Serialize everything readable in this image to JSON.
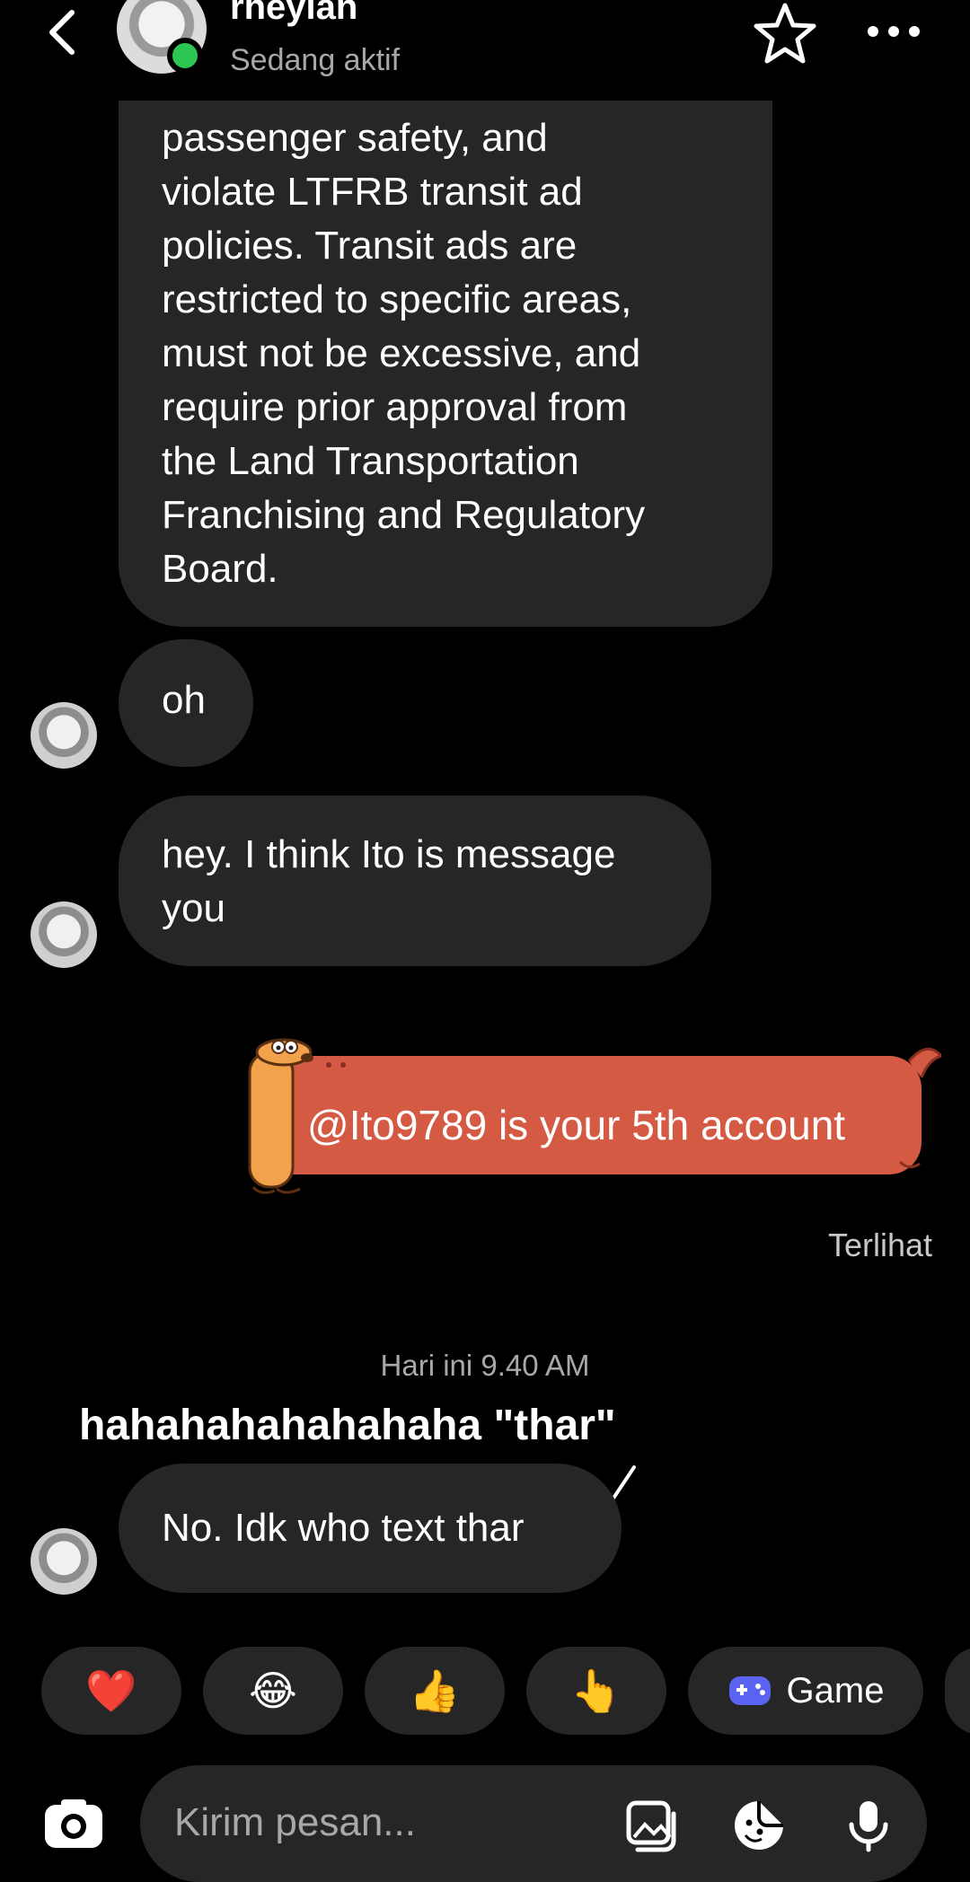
{
  "header": {
    "name": "rheylan",
    "status": "Sedang aktif"
  },
  "messages": {
    "received_long": "passenger safety, and\nviolate LTFRB transit ad\npolicies. Transit ads are\nrestricted to specific areas,\nmust not be excessive, and\nrequire prior approval from\nthe Land Transportation\nFranchising and Regulatory\nBoard.",
    "received_oh": "oh",
    "received_hey": "hey. I think Ito is message you",
    "sent": "@Ito9789 is your 5th account",
    "seen": "Terlihat",
    "timestamp": "Hari ini 9.40 AM",
    "received_last": "No. Idk who text thar"
  },
  "overlay": {
    "caption": "hahahahahahahaha \"thar\""
  },
  "quick_replies": [
    {
      "emoji": "❤️"
    },
    {
      "emoji": "😂"
    },
    {
      "emoji": "👍"
    },
    {
      "emoji": "👆"
    },
    {
      "label": "Game"
    }
  ],
  "composer": {
    "placeholder": "Kirim pesan..."
  },
  "colors": {
    "background": "#000000",
    "bubble": "#262626",
    "sent_bubble": "#d45a44",
    "online": "#2dc653"
  }
}
